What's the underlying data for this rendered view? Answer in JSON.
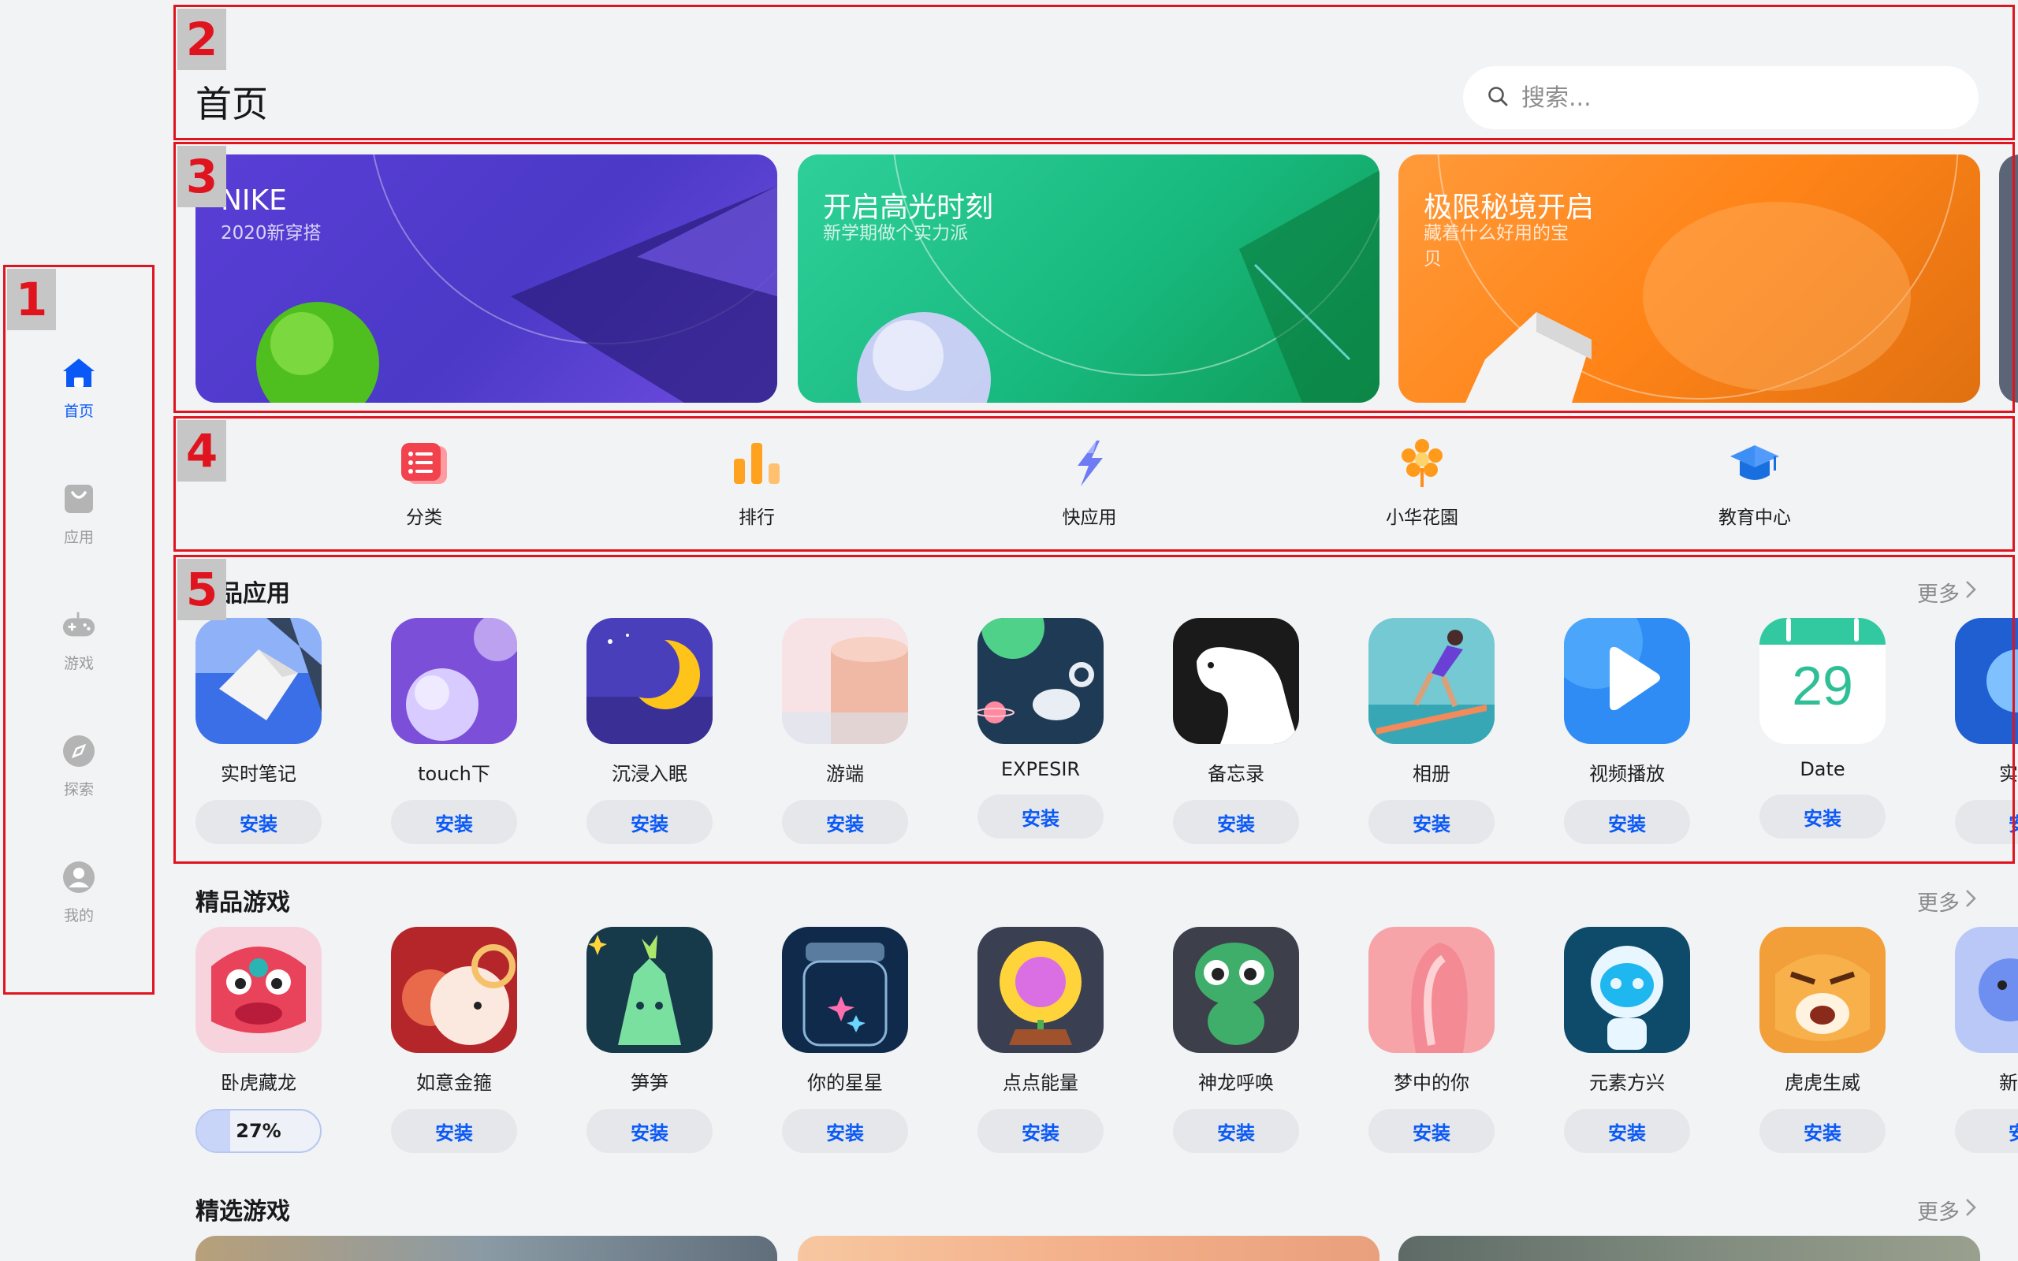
{
  "sidebar": {
    "items": [
      {
        "label": "首页",
        "icon": "home-icon",
        "active": true
      },
      {
        "label": "应用",
        "icon": "bag-icon",
        "active": false
      },
      {
        "label": "游戏",
        "icon": "gamepad-icon",
        "active": false
      },
      {
        "label": "探索",
        "icon": "compass-icon",
        "active": false
      },
      {
        "label": "我的",
        "icon": "user-icon",
        "active": false
      }
    ]
  },
  "header": {
    "title": "首页",
    "search_placeholder": "搜索..."
  },
  "banners": [
    {
      "title": "NIKE",
      "subtitle": "2020新穿搭"
    },
    {
      "title": "开启高光时刻",
      "subtitle": "新学期做个实力派"
    },
    {
      "title": "极限秘境开启",
      "subtitle": "藏着什么好用的宝贝"
    }
  ],
  "quick_entries": [
    {
      "label": "分类",
      "icon": "category-icon"
    },
    {
      "label": "排行",
      "icon": "ranking-icon"
    },
    {
      "label": "快应用",
      "icon": "lightning-icon"
    },
    {
      "label": "小华花園",
      "icon": "flower-icon"
    },
    {
      "label": "教育中心",
      "icon": "graduation-cap-icon"
    }
  ],
  "featured_apps": {
    "title": "精品应用",
    "more": "更多",
    "apps": [
      {
        "name": "实时笔记",
        "button": "安装"
      },
      {
        "name": "touch下",
        "button": "安装"
      },
      {
        "name": "沉浸入眠",
        "button": "安装"
      },
      {
        "name": "游端",
        "button": "安装"
      },
      {
        "name": "EXPESIR",
        "button": "安装"
      },
      {
        "name": "备忘录",
        "button": "安装"
      },
      {
        "name": "相册",
        "button": "安装"
      },
      {
        "name": "视频播放",
        "button": "安装"
      },
      {
        "name": "Date",
        "button": "安装"
      },
      {
        "name": "实时",
        "button": "安"
      }
    ],
    "date_number": "29"
  },
  "featured_games": {
    "title": "精品游戏",
    "more": "更多",
    "games": [
      {
        "name": "卧虎藏龙",
        "progress_label": "27%",
        "progress": 0.27
      },
      {
        "name": "如意金箍",
        "button": "安装"
      },
      {
        "name": "笋笋",
        "button": "安装"
      },
      {
        "name": "你的星星",
        "button": "安装"
      },
      {
        "name": "点点能量",
        "button": "安装"
      },
      {
        "name": "神龙呼唤",
        "button": "安装"
      },
      {
        "name": "梦中的你",
        "button": "安装"
      },
      {
        "name": "元素方兴",
        "button": "安装"
      },
      {
        "name": "虎虎生威",
        "button": "安装"
      },
      {
        "name": "新屋",
        "button": "安"
      }
    ]
  },
  "selected_games": {
    "title": "精选游戏",
    "more": "更多"
  },
  "annotations": [
    "1",
    "2",
    "3",
    "4",
    "5"
  ],
  "colors": {
    "accent": "#0a59f7",
    "background": "#f1f3f5",
    "annotation": "#e0141e"
  }
}
